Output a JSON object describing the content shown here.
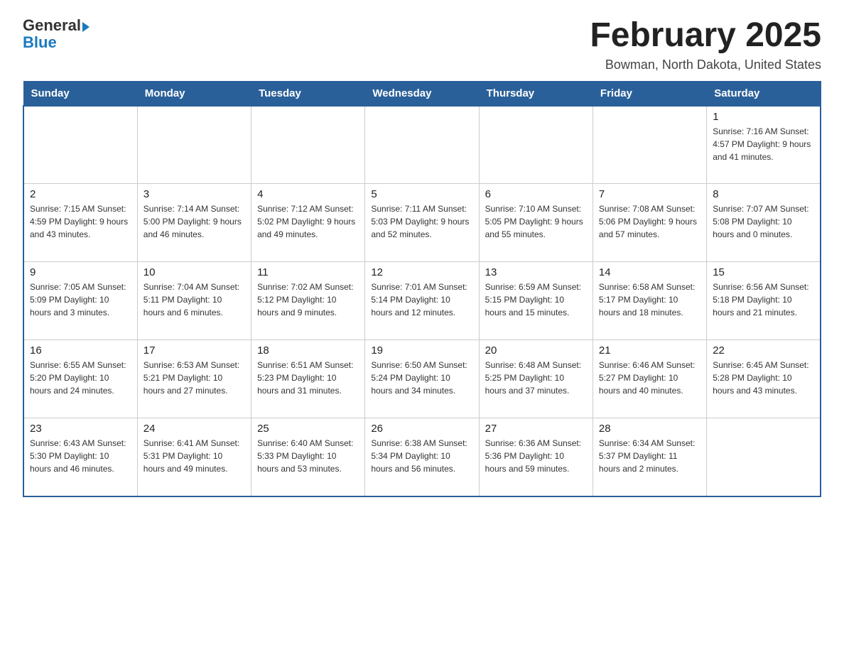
{
  "header": {
    "logo_general": "General",
    "logo_blue": "Blue",
    "month_year": "February 2025",
    "location": "Bowman, North Dakota, United States"
  },
  "days_of_week": [
    "Sunday",
    "Monday",
    "Tuesday",
    "Wednesday",
    "Thursday",
    "Friday",
    "Saturday"
  ],
  "weeks": [
    [
      {
        "day": "",
        "info": ""
      },
      {
        "day": "",
        "info": ""
      },
      {
        "day": "",
        "info": ""
      },
      {
        "day": "",
        "info": ""
      },
      {
        "day": "",
        "info": ""
      },
      {
        "day": "",
        "info": ""
      },
      {
        "day": "1",
        "info": "Sunrise: 7:16 AM\nSunset: 4:57 PM\nDaylight: 9 hours and 41 minutes."
      }
    ],
    [
      {
        "day": "2",
        "info": "Sunrise: 7:15 AM\nSunset: 4:59 PM\nDaylight: 9 hours and 43 minutes."
      },
      {
        "day": "3",
        "info": "Sunrise: 7:14 AM\nSunset: 5:00 PM\nDaylight: 9 hours and 46 minutes."
      },
      {
        "day": "4",
        "info": "Sunrise: 7:12 AM\nSunset: 5:02 PM\nDaylight: 9 hours and 49 minutes."
      },
      {
        "day": "5",
        "info": "Sunrise: 7:11 AM\nSunset: 5:03 PM\nDaylight: 9 hours and 52 minutes."
      },
      {
        "day": "6",
        "info": "Sunrise: 7:10 AM\nSunset: 5:05 PM\nDaylight: 9 hours and 55 minutes."
      },
      {
        "day": "7",
        "info": "Sunrise: 7:08 AM\nSunset: 5:06 PM\nDaylight: 9 hours and 57 minutes."
      },
      {
        "day": "8",
        "info": "Sunrise: 7:07 AM\nSunset: 5:08 PM\nDaylight: 10 hours and 0 minutes."
      }
    ],
    [
      {
        "day": "9",
        "info": "Sunrise: 7:05 AM\nSunset: 5:09 PM\nDaylight: 10 hours and 3 minutes."
      },
      {
        "day": "10",
        "info": "Sunrise: 7:04 AM\nSunset: 5:11 PM\nDaylight: 10 hours and 6 minutes."
      },
      {
        "day": "11",
        "info": "Sunrise: 7:02 AM\nSunset: 5:12 PM\nDaylight: 10 hours and 9 minutes."
      },
      {
        "day": "12",
        "info": "Sunrise: 7:01 AM\nSunset: 5:14 PM\nDaylight: 10 hours and 12 minutes."
      },
      {
        "day": "13",
        "info": "Sunrise: 6:59 AM\nSunset: 5:15 PM\nDaylight: 10 hours and 15 minutes."
      },
      {
        "day": "14",
        "info": "Sunrise: 6:58 AM\nSunset: 5:17 PM\nDaylight: 10 hours and 18 minutes."
      },
      {
        "day": "15",
        "info": "Sunrise: 6:56 AM\nSunset: 5:18 PM\nDaylight: 10 hours and 21 minutes."
      }
    ],
    [
      {
        "day": "16",
        "info": "Sunrise: 6:55 AM\nSunset: 5:20 PM\nDaylight: 10 hours and 24 minutes."
      },
      {
        "day": "17",
        "info": "Sunrise: 6:53 AM\nSunset: 5:21 PM\nDaylight: 10 hours and 27 minutes."
      },
      {
        "day": "18",
        "info": "Sunrise: 6:51 AM\nSunset: 5:23 PM\nDaylight: 10 hours and 31 minutes."
      },
      {
        "day": "19",
        "info": "Sunrise: 6:50 AM\nSunset: 5:24 PM\nDaylight: 10 hours and 34 minutes."
      },
      {
        "day": "20",
        "info": "Sunrise: 6:48 AM\nSunset: 5:25 PM\nDaylight: 10 hours and 37 minutes."
      },
      {
        "day": "21",
        "info": "Sunrise: 6:46 AM\nSunset: 5:27 PM\nDaylight: 10 hours and 40 minutes."
      },
      {
        "day": "22",
        "info": "Sunrise: 6:45 AM\nSunset: 5:28 PM\nDaylight: 10 hours and 43 minutes."
      }
    ],
    [
      {
        "day": "23",
        "info": "Sunrise: 6:43 AM\nSunset: 5:30 PM\nDaylight: 10 hours and 46 minutes."
      },
      {
        "day": "24",
        "info": "Sunrise: 6:41 AM\nSunset: 5:31 PM\nDaylight: 10 hours and 49 minutes."
      },
      {
        "day": "25",
        "info": "Sunrise: 6:40 AM\nSunset: 5:33 PM\nDaylight: 10 hours and 53 minutes."
      },
      {
        "day": "26",
        "info": "Sunrise: 6:38 AM\nSunset: 5:34 PM\nDaylight: 10 hours and 56 minutes."
      },
      {
        "day": "27",
        "info": "Sunrise: 6:36 AM\nSunset: 5:36 PM\nDaylight: 10 hours and 59 minutes."
      },
      {
        "day": "28",
        "info": "Sunrise: 6:34 AM\nSunset: 5:37 PM\nDaylight: 11 hours and 2 minutes."
      },
      {
        "day": "",
        "info": ""
      }
    ]
  ]
}
